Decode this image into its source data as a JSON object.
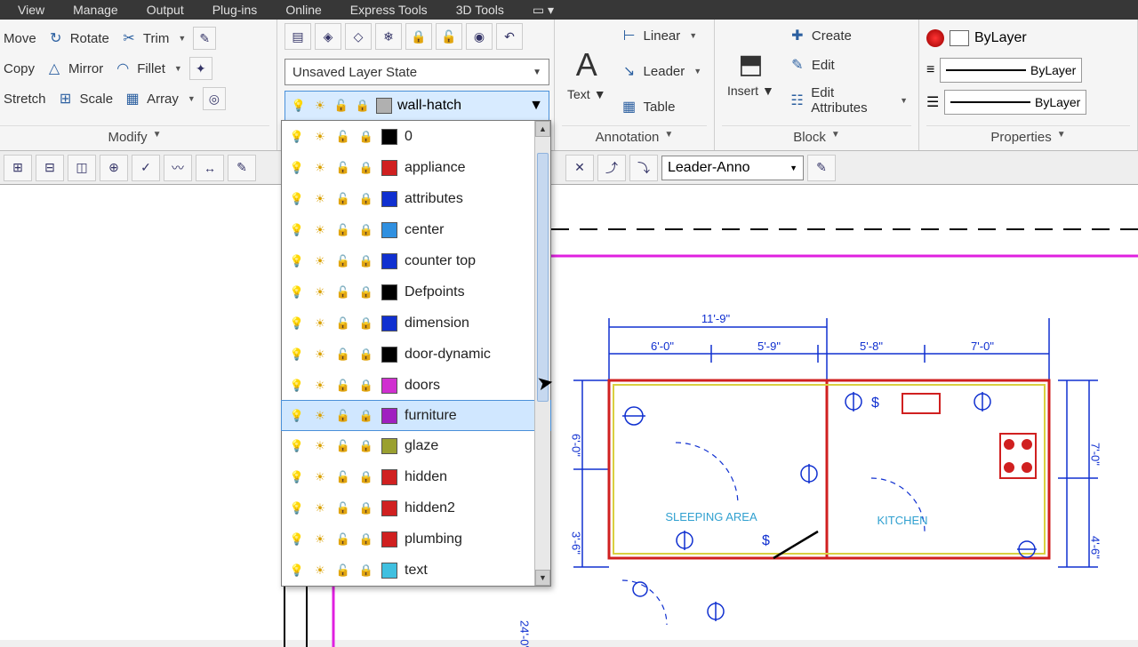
{
  "menubar": [
    "View",
    "Manage",
    "Output",
    "Plug-ins",
    "Online",
    "Express Tools",
    "3D Tools"
  ],
  "modify": {
    "title": "Modify",
    "items": [
      {
        "icon": "↺",
        "label": "Move"
      },
      {
        "icon": "↻",
        "label": "Rotate"
      },
      {
        "icon": "✂",
        "label": "Trim"
      },
      {
        "icon": "⇄",
        "label": "Copy"
      },
      {
        "icon": "△",
        "label": "Mirror"
      },
      {
        "icon": "◠",
        "label": "Fillet"
      },
      {
        "icon": "⇲",
        "label": "Stretch"
      },
      {
        "icon": "⊞",
        "label": "Scale"
      },
      {
        "icon": "▦",
        "label": "Array"
      }
    ]
  },
  "layers": {
    "state": "Unsaved Layer State",
    "current": "wall-hatch",
    "currentSwatch": "#b0b0b0",
    "list": [
      {
        "name": "0",
        "color": "#000000"
      },
      {
        "name": "appliance",
        "color": "#d02020"
      },
      {
        "name": "attributes",
        "color": "#1030d0"
      },
      {
        "name": "center",
        "color": "#3090e0"
      },
      {
        "name": "counter top",
        "color": "#1030d0"
      },
      {
        "name": "Defpoints",
        "color": "#000000"
      },
      {
        "name": "dimension",
        "color": "#1030d0"
      },
      {
        "name": "door-dynamic",
        "color": "#000000"
      },
      {
        "name": "doors",
        "color": "#d030d0"
      },
      {
        "name": "furniture",
        "color": "#a020c0",
        "selected": true
      },
      {
        "name": "glaze",
        "color": "#9aa030"
      },
      {
        "name": "hidden",
        "color": "#d02020"
      },
      {
        "name": "hidden2",
        "color": "#d02020"
      },
      {
        "name": "plumbing",
        "color": "#d02020"
      },
      {
        "name": "text",
        "color": "#40c0e0"
      }
    ]
  },
  "annotation": {
    "title": "Annotation",
    "text": "Text",
    "items": [
      "Linear",
      "Leader",
      "Table"
    ]
  },
  "block": {
    "title": "Block",
    "insert": "Insert",
    "items": [
      "Create",
      "Edit",
      "Edit Attributes"
    ]
  },
  "properties": {
    "title": "Properties",
    "rows": [
      {
        "label": "ByLayer",
        "circle": "#d02020"
      },
      {
        "label": "ByLayer",
        "line": true
      },
      {
        "label": "ByLayer",
        "line": true
      }
    ]
  },
  "toolbar2": {
    "leader": "Leader-Anno"
  },
  "drawing": {
    "dims": [
      "11'-9\"",
      "6'-0\"",
      "5'-9\"",
      "5'-8\"",
      "7'-0\"",
      "6'-0\"",
      "3'-6\"",
      "24'-0\"",
      "7'-0\"",
      "4'-6\""
    ],
    "labels": [
      "SLEEPING AREA",
      "KITCHEN"
    ]
  }
}
